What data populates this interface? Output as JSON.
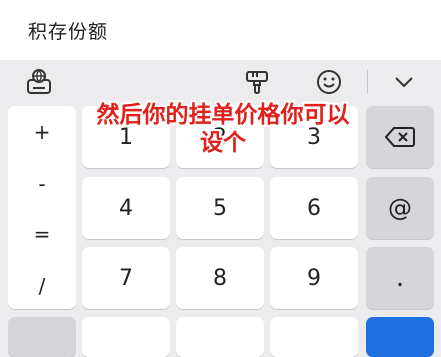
{
  "field": {
    "label": "积存份额"
  },
  "toolbar": {
    "icons": [
      "keyboard-settings-icon",
      "paint-brush-icon",
      "emoji-icon",
      "collapse-keyboard-icon"
    ]
  },
  "keyboard": {
    "symbols": [
      "+",
      "-",
      "=",
      "/"
    ],
    "row1": [
      "1",
      "2",
      "3"
    ],
    "row2": [
      "4",
      "5",
      "6"
    ],
    "row3": [
      "7",
      "8",
      "9"
    ],
    "right": {
      "at": "@",
      "dot": "."
    }
  },
  "overlay": {
    "line1": "然后你的挂单价格你可以",
    "line2": "设个"
  },
  "colors": {
    "overlay_text": "#e0201b",
    "enter_key": "#1f6fe0"
  }
}
